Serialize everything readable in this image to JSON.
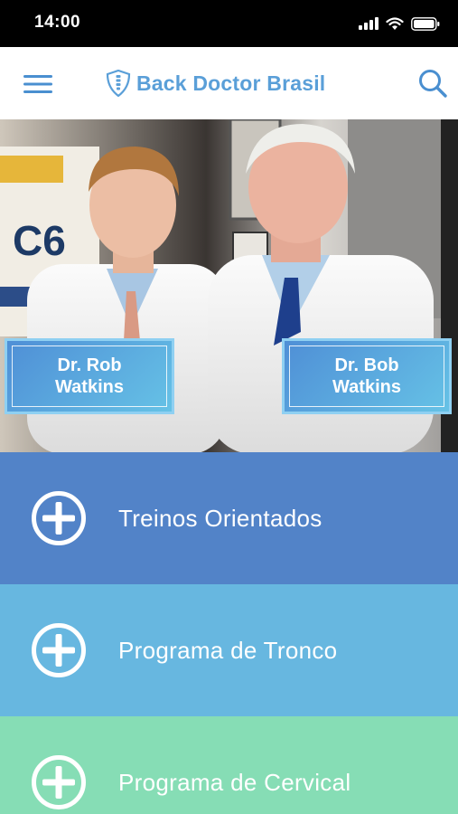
{
  "status_bar": {
    "time": "14:00"
  },
  "header": {
    "title": "Back Doctor Brasil"
  },
  "hero": {
    "doctors": [
      {
        "line1": "Dr. Rob",
        "line2": "Watkins"
      },
      {
        "line1": "Dr. Bob",
        "line2": "Watkins"
      }
    ]
  },
  "menu": {
    "items": [
      {
        "label": "Treinos Orientados",
        "color": "#5283c8",
        "icon": "plus-circle-icon"
      },
      {
        "label": "Programa de Tronco",
        "color": "#67b7e0",
        "icon": "plus-circle-icon"
      },
      {
        "label": "Programa de Cervical",
        "color": "#86ddb5",
        "icon": "plus-circle-icon"
      }
    ]
  },
  "colors": {
    "brand": "#5a9fd8",
    "status_bg": "#000000"
  }
}
